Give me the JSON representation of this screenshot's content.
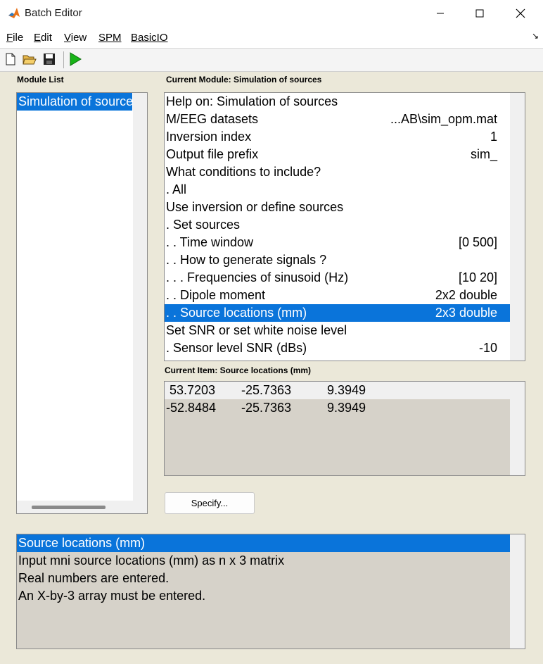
{
  "window": {
    "title": "Batch Editor"
  },
  "menu": [
    {
      "label": "File",
      "u": "F",
      "rest": "ile"
    },
    {
      "label": "Edit",
      "u": "E",
      "rest": "dit"
    },
    {
      "label": "View",
      "u": "V",
      "rest": "iew"
    },
    {
      "label": "SPM",
      "u": "SPM",
      "rest": ""
    },
    {
      "label": "BasicIO",
      "u": "BasicIO",
      "rest": ""
    }
  ],
  "module_list": {
    "label": "Module List",
    "items": [
      "Simulation of sources"
    ]
  },
  "current_module": {
    "label": "Current Module: Simulation of sources",
    "rows": [
      {
        "label": "Help on: Simulation of sources",
        "value": ""
      },
      {
        "label": "M/EEG datasets",
        "value": "...AB\\sim_opm.mat"
      },
      {
        "label": "Inversion index",
        "value": "1"
      },
      {
        "label": "Output file prefix",
        "value": "sim_"
      },
      {
        "label": "What conditions to include?",
        "value": ""
      },
      {
        "label": " . All",
        "value": ""
      },
      {
        "label": "Use inversion or define sources",
        "value": ""
      },
      {
        "label": " . Set sources",
        "value": ""
      },
      {
        "label": " . . Time window",
        "value": "[0 500]"
      },
      {
        "label": " . . How to generate signals ?",
        "value": ""
      },
      {
        "label": " . . . Frequencies of sinusoid (Hz)",
        "value": "[10 20]"
      },
      {
        "label": " . . Dipole moment",
        "value": "2x2 double"
      },
      {
        "label": " . . Source locations (mm)",
        "value": "2x3 double"
      },
      {
        "label": "Set SNR or set white noise level",
        "value": ""
      },
      {
        "label": " . Sensor level SNR (dBs)",
        "value": "-10"
      }
    ],
    "selected_index": 12
  },
  "current_item": {
    "label": "Current Item: Source locations (mm)",
    "matrix": [
      [
        "53.7203",
        "-25.7363",
        "9.3949"
      ],
      [
        "-52.8484",
        "-25.7363",
        "9.3949"
      ]
    ]
  },
  "specify_button": {
    "label": "Specify..."
  },
  "help": {
    "lines": [
      "Source locations (mm)",
      "Input mni source locations (mm) as n x 3 matrix",
      "Real numbers are entered.",
      "An X-by-3 array must be entered."
    ]
  },
  "colors": {
    "selection": "#0a74da",
    "background": "#ebe8d9",
    "run_green": "#18b418"
  },
  "icons": [
    "matlab-icon",
    "minimize-icon",
    "maximize-icon",
    "close-icon",
    "new-file-icon",
    "open-folder-icon",
    "save-icon",
    "run-icon"
  ]
}
